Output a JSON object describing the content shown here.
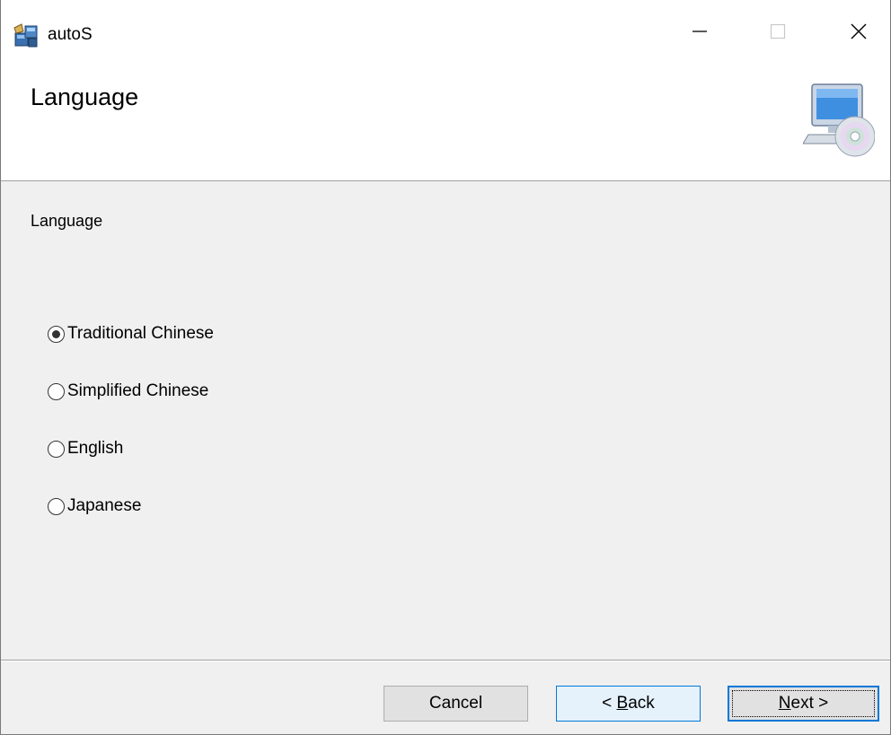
{
  "window": {
    "title": "autoS",
    "icon": "installer-package-icon"
  },
  "controls": {
    "minimize_icon": "minimize-icon",
    "maximize_icon": "maximize-icon",
    "close_icon": "close-icon"
  },
  "header": {
    "title": "Language",
    "graphic": "computer-cd-icon"
  },
  "section": {
    "label": "Language"
  },
  "options": [
    {
      "label": "Traditional Chinese",
      "selected": true
    },
    {
      "label": "Simplified Chinese",
      "selected": false
    },
    {
      "label": "English",
      "selected": false
    },
    {
      "label": "Japanese",
      "selected": false
    }
  ],
  "buttons": {
    "cancel": "Cancel",
    "back_prefix": "< ",
    "back_mnemonic": "B",
    "back_rest": "ack",
    "next_mnemonic": "N",
    "next_rest": "ext >"
  },
  "colors": {
    "accent": "#0078d7",
    "face": "#f0f0f0",
    "header_bg": "#ffffff"
  }
}
